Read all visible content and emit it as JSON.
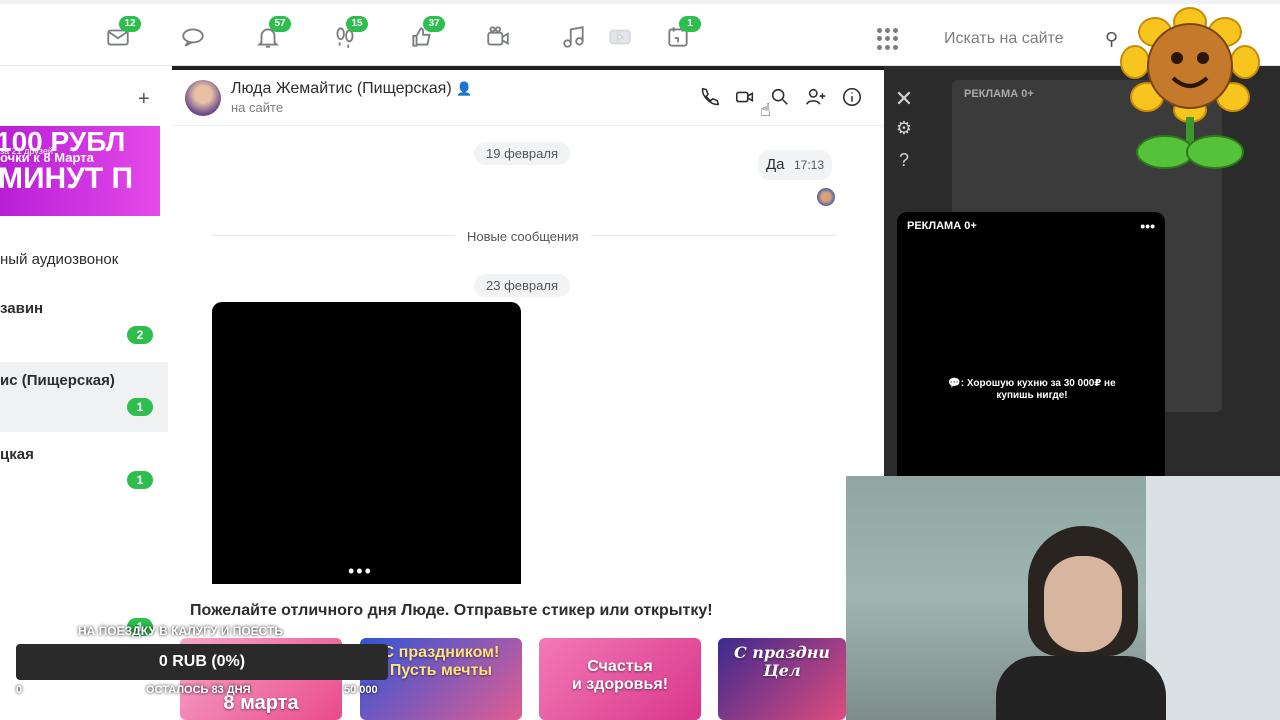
{
  "nav": {
    "items": [
      {
        "name": "mail",
        "badge": "12"
      },
      {
        "name": "discussions",
        "badge": ""
      },
      {
        "name": "notifications",
        "badge": "57"
      },
      {
        "name": "guests",
        "badge": "15"
      },
      {
        "name": "likes",
        "badge": "37"
      },
      {
        "name": "video",
        "badge": ""
      },
      {
        "name": "music",
        "badge": ""
      },
      {
        "name": "games",
        "badge": ""
      },
      {
        "name": "events",
        "badge": "1"
      }
    ],
    "search_placeholder": "Искать на сайте"
  },
  "left": {
    "promo": {
      "line1": "100 РУБЛ",
      "line2": "очки к 8 Марта",
      "line3": "МИНУТ П",
      "sub": "за 21 друзей"
    },
    "rows": [
      {
        "text": "ный аудиозвонок",
        "bold": false
      },
      {
        "text": "завин",
        "bold": true,
        "count": "2"
      },
      {
        "text": "ис (Пищерская)",
        "bold": true,
        "count": "1"
      },
      {
        "text": "цкая",
        "bold": true,
        "count": "1"
      }
    ],
    "bottom_count": "1"
  },
  "chat": {
    "name": "Люда Жемайтис (Пищерская)",
    "status": "на сайте",
    "dates": [
      "19 февраля",
      "Новые сообщения",
      "23 февраля"
    ],
    "message": {
      "text": "Да",
      "time": "17:13"
    },
    "wish": "Пожелайте отличного дня Люде. Отправьте стикер или открытку!",
    "cards": [
      {
        "caption": "8 марта",
        "color": "#e94b8a"
      },
      {
        "caption": "С праздником!\nПусть мечты",
        "color": "#3f58c9"
      },
      {
        "caption": "Счастья\nи здоровья!",
        "color": "#e4579a"
      },
      {
        "caption": "С праздни\nЦел",
        "color": "#5a4bb4"
      }
    ]
  },
  "ads": {
    "label": "РЕКЛАМА 0+",
    "text": "💬: Хорошую кухню за 30 000₽ не купишь нигде!"
  },
  "donation": {
    "goal": "НА ПОЕЗДКУ В КАЛУГУ И ПОЕСТЬ",
    "value": "0 RUB (0%)",
    "left_text": "ОСТАЛОСЬ 83 ДНЯ",
    "target": "50 000",
    "zero": "0"
  }
}
